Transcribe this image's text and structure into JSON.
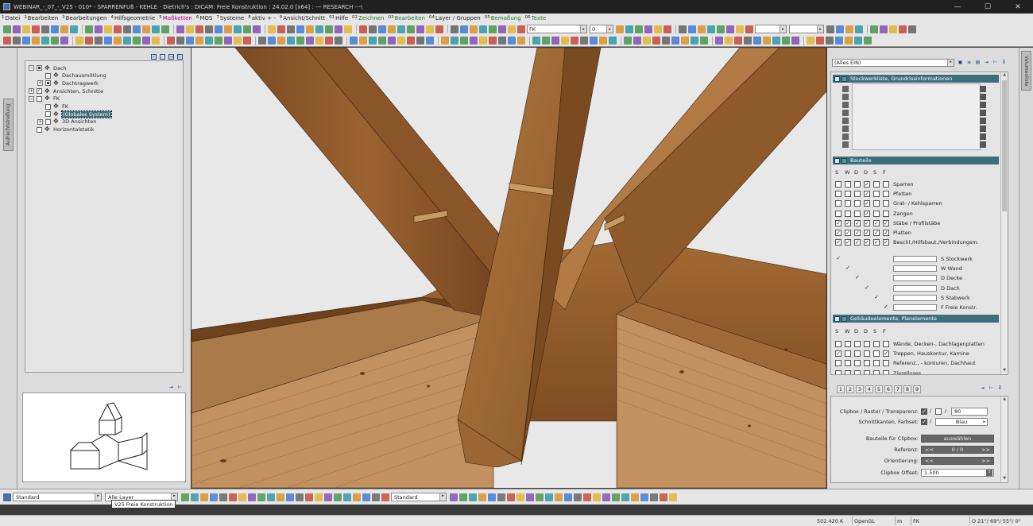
{
  "window": {
    "title": "WEBINAR_-_07_-_V25 - 010* - SPARRENFUß - KEHLE - Dietrich's : DICAM: Freie Konstruktion : 24.02.0 [x64] : --- RESEARCH ---\\",
    "minimize": "—",
    "maximize": "☐",
    "close": "✕"
  },
  "menu": [
    {
      "key": "1",
      "label": "Datei",
      "color": "#1e1e1e"
    },
    {
      "key": "2",
      "label": "Bearbeiten",
      "color": "#1e1e1e"
    },
    {
      "key": "3",
      "label": "Bearbeitungen",
      "color": "#1e1e1e"
    },
    {
      "key": "4",
      "label": "Hilfsgeometrie",
      "color": "#1e1e1e"
    },
    {
      "key": "5",
      "label": "Maßketten",
      "color": "#b0008a"
    },
    {
      "key": "6",
      "label": "MOS",
      "color": "#1e1e1e"
    },
    {
      "key": "7",
      "label": "Systeme",
      "color": "#1e1e1e"
    },
    {
      "key": "8",
      "label": "aktiv + -",
      "color": "#1e1e1e"
    },
    {
      "key": "9",
      "label": "Ansicht/Schnitt",
      "color": "#1e1e1e"
    },
    {
      "key": "01",
      "label": "Hilfe",
      "color": "#1e1e1e"
    },
    {
      "key": "02",
      "label": "Zeichnen",
      "color": "#1f7a2a"
    },
    {
      "key": "03",
      "label": "Bearbeiten",
      "color": "#1f7a2a"
    },
    {
      "key": "04",
      "label": "Layer / Gruppen",
      "color": "#1e1e1e"
    },
    {
      "key": "05",
      "label": "Bemaßung",
      "color": "#1f7a2a"
    },
    {
      "key": "06",
      "label": "Texte",
      "color": "#1f7a2a"
    }
  ],
  "toolbar": {
    "layer_combo": "FK",
    "number_combo": "0"
  },
  "left_strip": {
    "tab_label": "Aufrechtstreifung"
  },
  "tree": {
    "items": [
      {
        "label": "Dach",
        "expander": "−",
        "check": "on",
        "indent": 0
      },
      {
        "label": "Dachausmittlung",
        "expander": "",
        "check": "",
        "indent": 1
      },
      {
        "label": "Dachtragwerk",
        "expander": "+",
        "check": "on",
        "indent": 1
      },
      {
        "label": "Ansichten, Schnitte",
        "expander": "+",
        "check": "tick",
        "indent": 0
      },
      {
        "label": "FK",
        "expander": "−",
        "check": "",
        "indent": 0
      },
      {
        "label": "FK",
        "expander": "",
        "check": "",
        "indent": 1
      },
      {
        "label": "(Globales System)",
        "expander": "",
        "check": "",
        "indent": 1,
        "selected": true
      },
      {
        "label": "3D Ansichten",
        "expander": "+",
        "check": "",
        "indent": 1
      },
      {
        "label": "Horizontalstatik",
        "expander": "",
        "check": "",
        "indent": 0
      }
    ]
  },
  "right_strip": {
    "tab_label": "Volumenliste"
  },
  "filter": {
    "value": "(Alles EIN)"
  },
  "sections": {
    "stockwerk": "Stockwerkliste, Grundrissinformationen",
    "bauteile": "Bauteile",
    "gebaeude": "Gebäudeelemente, Planelemente"
  },
  "col_headers": [
    "S",
    "W",
    "D",
    "D",
    "S",
    "F"
  ],
  "bauteile": [
    {
      "label": "Sparren",
      "checks": [
        0,
        0,
        0,
        1,
        0,
        0
      ]
    },
    {
      "label": "Pfetten",
      "checks": [
        0,
        0,
        0,
        1,
        0,
        0
      ]
    },
    {
      "label": "Grat- / Kehlsparren",
      "checks": [
        0,
        0,
        0,
        1,
        0,
        0
      ]
    },
    {
      "label": "Zangen",
      "checks": [
        0,
        0,
        0,
        1,
        0,
        0
      ]
    },
    {
      "label": "Stäbe / Profilstäbe",
      "checks": [
        1,
        1,
        1,
        1,
        1,
        1
      ]
    },
    {
      "label": "Platten",
      "checks": [
        1,
        1,
        1,
        1,
        1,
        1
      ]
    },
    {
      "label": "Beschl./Hilfsbaut./Verbindungsm.",
      "checks": [
        1,
        1,
        1,
        1,
        1,
        1
      ]
    }
  ],
  "system_layers": [
    {
      "label": "S Stockwerk",
      "col": 0
    },
    {
      "label": "W Wand",
      "col": 1
    },
    {
      "label": "D Decke",
      "col": 2
    },
    {
      "label": "D Dach",
      "col": 3
    },
    {
      "label": "S Stabwerk",
      "col": 4
    },
    {
      "label": "F Freie Konstr.",
      "col": 5
    }
  ],
  "gebaeude": [
    {
      "label": "Wände, Decken-, Dachlagenplatten",
      "checks": [
        0,
        0,
        0,
        0,
        0,
        0
      ]
    },
    {
      "label": "Treppen, Hauskontur, Kamine",
      "checks": [
        1,
        0,
        0,
        0,
        0,
        1
      ]
    },
    {
      "label": "Referenz., - konturen, Dachhaut",
      "checks": [
        0,
        0,
        0,
        0,
        0,
        0
      ]
    },
    {
      "label": "Zierelloses",
      "checks": [
        0,
        0,
        0,
        0,
        0,
        0
      ]
    }
  ],
  "tabs": [
    "1",
    "2",
    "3",
    "4",
    "5",
    "6",
    "7",
    "8",
    "9"
  ],
  "clipbox": {
    "row1_label": "Clipbox / Raster / Transparenz:",
    "transparency": "80",
    "row2_label": "Schnittkanten, Farbset:",
    "color": "Blau",
    "bauteile_label": "Bauteile für Clipbox:",
    "bauteile_btn": "auswählen",
    "referenz_label": "Referenz:",
    "referenz_value": "0 / 0",
    "orient_label": "Orientierung:",
    "offset_label": "Clipbox Offset:",
    "offset_value": "1.500",
    "arrow_left": "<<",
    "arrow_right": ">>"
  },
  "bottom": {
    "combo1": "Standard",
    "combo2": "Alle Layer",
    "tooltip": "V25 Freie Konstruktion",
    "combo3": "Standard"
  },
  "status": {
    "memory": "502.420 K",
    "renderer": "OpenGL",
    "unit": "m",
    "layer": "FK",
    "angles": "O 21°/ 69°/ 55°/ 0°"
  }
}
